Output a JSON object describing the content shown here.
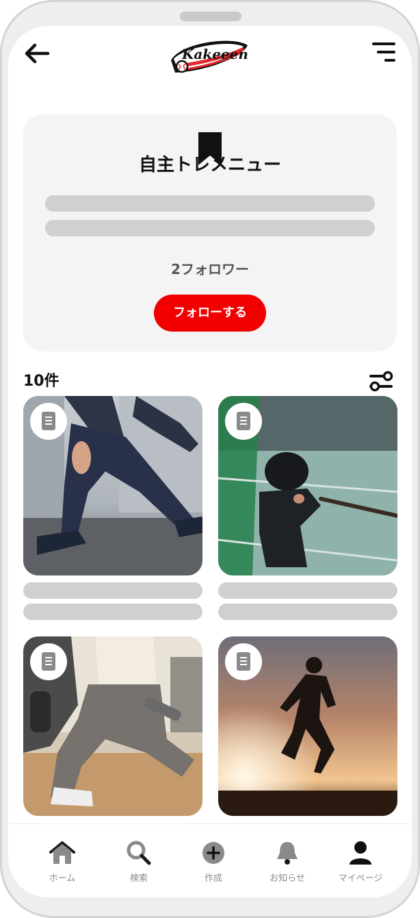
{
  "header": {
    "back_icon": "arrow-left-icon",
    "logo_text": "Kakeeen",
    "menu_icon": "menu-lines-icon"
  },
  "card": {
    "icon": "bookmark-icon",
    "title": "自主トレメニュー",
    "followers": "2フォロワー",
    "follow_button": "フォローする"
  },
  "list": {
    "count": "10件",
    "filter_icon": "filter-toggle-icon",
    "items": [
      {
        "type_icon": "document-icon",
        "image": "athlete-lunge-photo"
      },
      {
        "type_icon": "document-icon",
        "image": "child-batting-practice-photo"
      },
      {
        "type_icon": "document-icon",
        "image": "dumbbell-lunge-photo"
      },
      {
        "type_icon": "document-icon",
        "image": "runner-sunset-photo"
      }
    ]
  },
  "tabbar": {
    "home": "ホーム",
    "search": "検索",
    "create": "作成",
    "notifications": "お知らせ",
    "mypage": "マイページ"
  },
  "colors": {
    "accent": "#f20000",
    "placeholder": "#d0d0d0",
    "card_bg": "#f4f4f4",
    "tab_active": "#7f7f7f"
  }
}
